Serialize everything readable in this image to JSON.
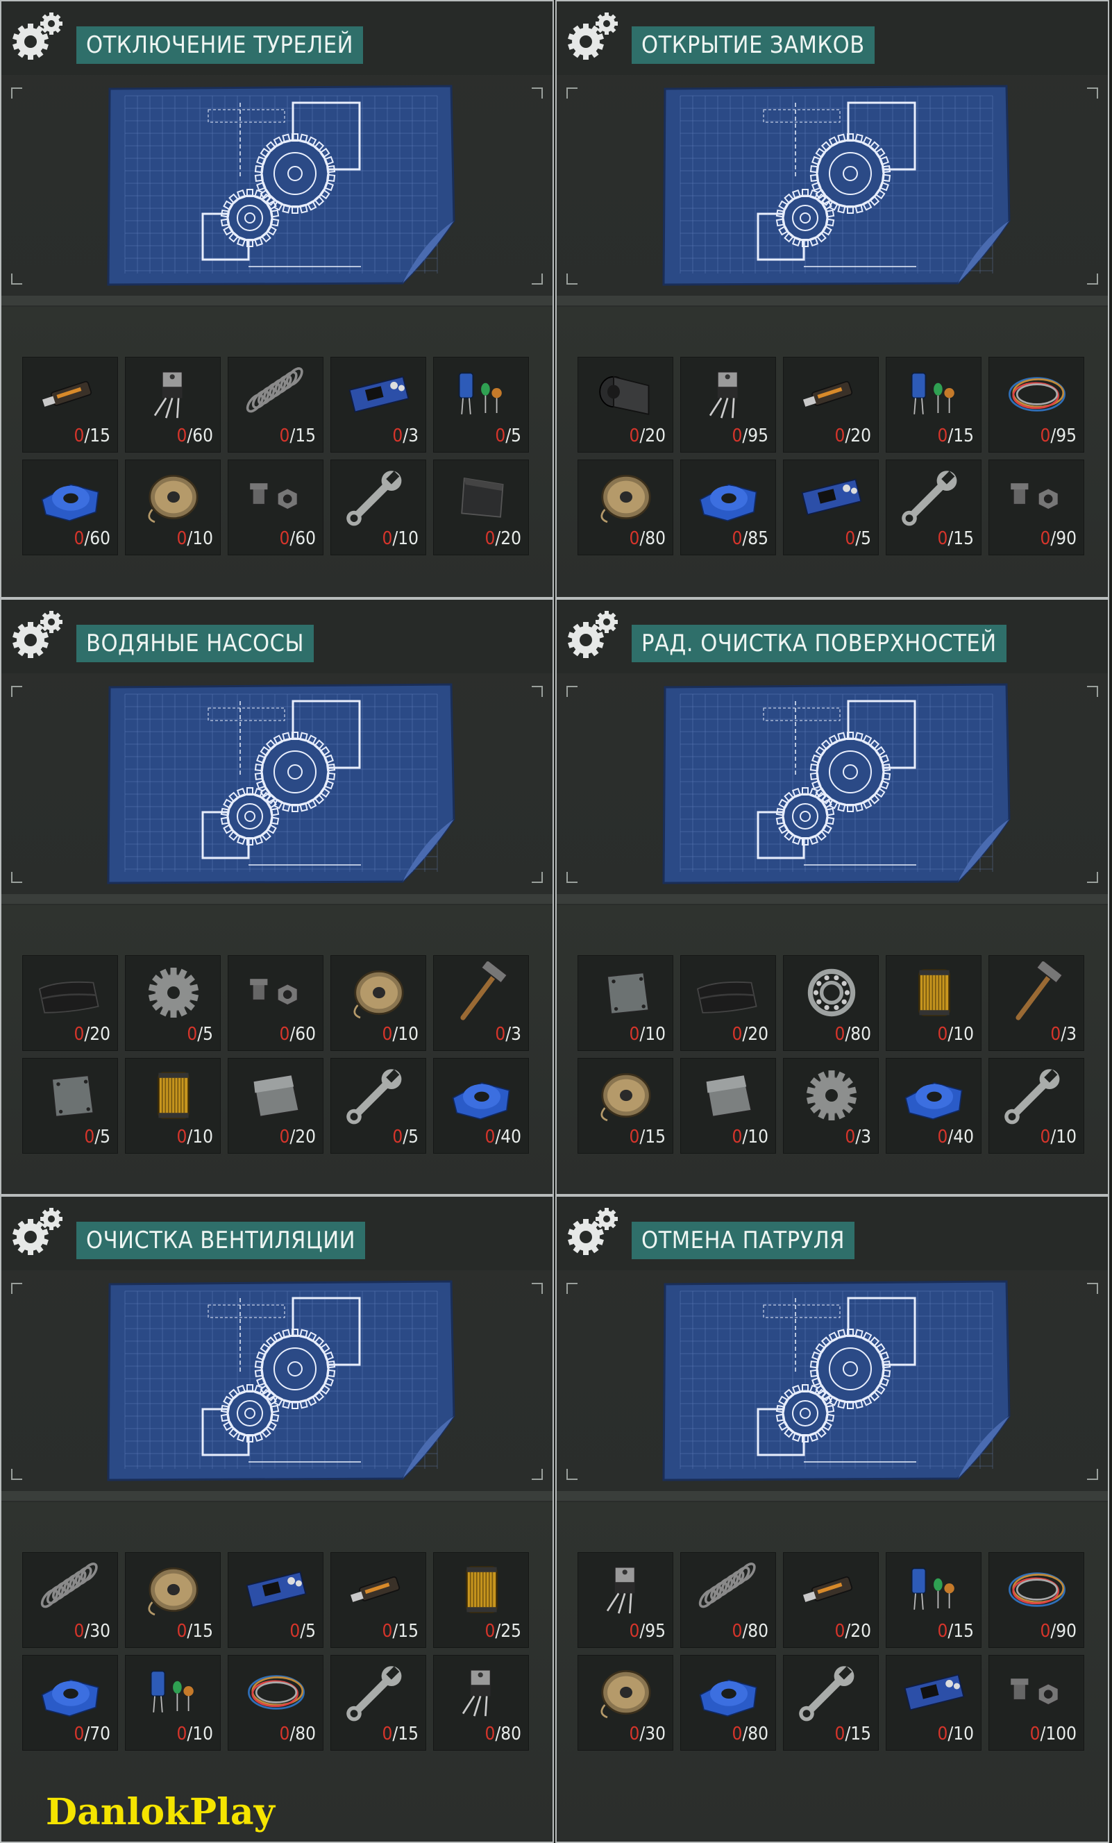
{
  "panels": [
    {
      "title": "ОТКЛЮЧЕНИЕ ТУРЕЛЕЙ",
      "items": [
        {
          "icon": "usb-drive-icon",
          "have": "0",
          "need": "/15"
        },
        {
          "icon": "transistor-icon",
          "have": "0",
          "need": "/60"
        },
        {
          "icon": "spring-icon",
          "have": "0",
          "need": "/15"
        },
        {
          "icon": "circuit-board-icon",
          "have": "0",
          "need": "/3"
        },
        {
          "icon": "capacitors-icon",
          "have": "0",
          "need": "/5"
        },
        {
          "icon": "duct-tape-icon",
          "have": "0",
          "need": "/60"
        },
        {
          "icon": "wire-spool-icon",
          "have": "0",
          "need": "/10"
        },
        {
          "icon": "bolt-nut-icon",
          "have": "0",
          "need": "/60"
        },
        {
          "icon": "wrench-icon",
          "have": "0",
          "need": "/10"
        },
        {
          "icon": "carbon-plate-icon",
          "have": "0",
          "need": "/20"
        }
      ]
    },
    {
      "title": "ОТКРЫТИЕ ЗАМКОВ",
      "items": [
        {
          "icon": "rubber-roll-icon",
          "have": "0",
          "need": "/20"
        },
        {
          "icon": "transistor-icon",
          "have": "0",
          "need": "/95"
        },
        {
          "icon": "usb-drive-icon",
          "have": "0",
          "need": "/20"
        },
        {
          "icon": "capacitors-icon",
          "have": "0",
          "need": "/15"
        },
        {
          "icon": "wire-bundle-icon",
          "have": "0",
          "need": "/95"
        },
        {
          "icon": "wire-spool-icon",
          "have": "0",
          "need": "/80"
        },
        {
          "icon": "duct-tape-icon",
          "have": "0",
          "need": "/85"
        },
        {
          "icon": "circuit-board-icon",
          "have": "0",
          "need": "/5"
        },
        {
          "icon": "wrench-icon",
          "have": "0",
          "need": "/15"
        },
        {
          "icon": "bolt-nut-icon",
          "have": "0",
          "need": "/90"
        }
      ]
    },
    {
      "title": "ВОДЯНЫЕ НАСОСЫ",
      "items": [
        {
          "icon": "rubber-sheet-icon",
          "have": "0",
          "need": "/20"
        },
        {
          "icon": "gear-part-icon",
          "have": "0",
          "need": "/5"
        },
        {
          "icon": "bolt-nut-icon",
          "have": "0",
          "need": "/60"
        },
        {
          "icon": "wire-spool-icon",
          "have": "0",
          "need": "/10"
        },
        {
          "icon": "hammer-icon",
          "have": "0",
          "need": "/3"
        },
        {
          "icon": "metal-plate-icon",
          "have": "0",
          "need": "/5"
        },
        {
          "icon": "filter-icon",
          "have": "0",
          "need": "/10"
        },
        {
          "icon": "steel-sheet-icon",
          "have": "0",
          "need": "/20"
        },
        {
          "icon": "wrench-icon",
          "have": "0",
          "need": "/5"
        },
        {
          "icon": "duct-tape-icon",
          "have": "0",
          "need": "/40"
        }
      ]
    },
    {
      "title": "РАД. ОЧИСТКА ПОВЕРХНОСТЕЙ",
      "items": [
        {
          "icon": "metal-plate-icon",
          "have": "0",
          "need": "/10"
        },
        {
          "icon": "rubber-sheet-icon",
          "have": "0",
          "need": "/20"
        },
        {
          "icon": "bearing-icon",
          "have": "0",
          "need": "/80"
        },
        {
          "icon": "filter-icon",
          "have": "0",
          "need": "/10"
        },
        {
          "icon": "hammer-icon",
          "have": "0",
          "need": "/3"
        },
        {
          "icon": "wire-spool-icon",
          "have": "0",
          "need": "/15"
        },
        {
          "icon": "steel-sheet-icon",
          "have": "0",
          "need": "/10"
        },
        {
          "icon": "gear-part-icon",
          "have": "0",
          "need": "/3"
        },
        {
          "icon": "duct-tape-icon",
          "have": "0",
          "need": "/40"
        },
        {
          "icon": "wrench-icon",
          "have": "0",
          "need": "/10"
        }
      ]
    },
    {
      "title": "ОЧИСТКА ВЕНТИЛЯЦИИ",
      "items": [
        {
          "icon": "spring-icon",
          "have": "0",
          "need": "/30"
        },
        {
          "icon": "wire-spool-icon",
          "have": "0",
          "need": "/15"
        },
        {
          "icon": "circuit-board-icon",
          "have": "0",
          "need": "/5"
        },
        {
          "icon": "usb-drive-icon",
          "have": "0",
          "need": "/15"
        },
        {
          "icon": "filter-icon",
          "have": "0",
          "need": "/25"
        },
        {
          "icon": "duct-tape-icon",
          "have": "0",
          "need": "/70"
        },
        {
          "icon": "capacitors-icon",
          "have": "0",
          "need": "/10"
        },
        {
          "icon": "wire-bundle-icon",
          "have": "0",
          "need": "/80"
        },
        {
          "icon": "wrench-icon",
          "have": "0",
          "need": "/15"
        },
        {
          "icon": "transistor-icon",
          "have": "0",
          "need": "/80"
        }
      ]
    },
    {
      "title": "ОТМЕНА ПАТРУЛЯ",
      "items": [
        {
          "icon": "transistor-icon",
          "have": "0",
          "need": "/95"
        },
        {
          "icon": "spring-icon",
          "have": "0",
          "need": "/80"
        },
        {
          "icon": "usb-drive-icon",
          "have": "0",
          "need": "/20"
        },
        {
          "icon": "capacitors-icon",
          "have": "0",
          "need": "/15"
        },
        {
          "icon": "wire-bundle-icon",
          "have": "0",
          "need": "/90"
        },
        {
          "icon": "wire-spool-icon",
          "have": "0",
          "need": "/30"
        },
        {
          "icon": "duct-tape-icon",
          "have": "0",
          "need": "/80"
        },
        {
          "icon": "wrench-icon",
          "have": "0",
          "need": "/15"
        },
        {
          "icon": "circuit-board-icon",
          "have": "0",
          "need": "/10"
        },
        {
          "icon": "bolt-nut-icon",
          "have": "0",
          "need": "/100"
        }
      ]
    }
  ],
  "watermark": "DanlokPlay",
  "colors": {
    "title_bg": "#2f6f6a",
    "have_count": "#d5352b",
    "blueprint": "#2b4a86",
    "watermark": "#f5e400"
  }
}
